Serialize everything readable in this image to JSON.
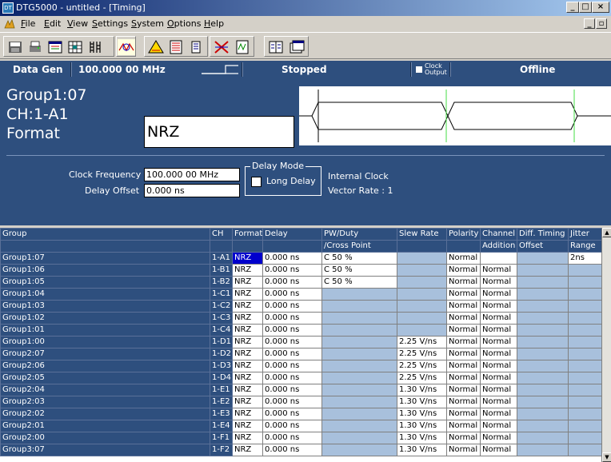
{
  "window": {
    "title": "DTG5000 - untitled - [Timing]",
    "app_icon": "DT"
  },
  "menu": [
    "File",
    "Edit",
    "View",
    "Settings",
    "System",
    "Options",
    "Help"
  ],
  "status": {
    "mode": "Data Gen",
    "frequency": "100.000 00 MHz",
    "run_state": "Stopped",
    "clock_output_line1": "Clock",
    "clock_output_line2": "Output",
    "connection": "Offline"
  },
  "channel": {
    "group": "Group1:07",
    "ch": "CH:1-A1",
    "format_label": "Format",
    "format_value": "NRZ"
  },
  "settings": {
    "clock_frequency_label": "Clock Frequency",
    "clock_frequency_value": "100.000 00 MHz",
    "delay_offset_label": "Delay Offset",
    "delay_offset_value": "0.000 ns",
    "delay_mode_legend": "Delay Mode",
    "long_delay_label": "Long Delay",
    "clock_source": "Internal Clock",
    "vector_rate": "Vector Rate : 1"
  },
  "grid": {
    "headers1": [
      "Group",
      "CH",
      "Format",
      "Delay",
      "PW/Duty",
      "Slew Rate",
      "Polarity",
      "Channel",
      "Diff. Timing",
      "Jitter"
    ],
    "headers2": [
      "",
      "",
      "",
      "",
      "/Cross Point",
      "",
      "",
      "Addition",
      "Offset",
      "Range"
    ],
    "rows": [
      [
        "Group1:07",
        "1-A1",
        "NRZ",
        "0.000 ns",
        "C 50 %",
        "",
        "Normal",
        "",
        "",
        "2ns"
      ],
      [
        "Group1:06",
        "1-B1",
        "NRZ",
        "0.000 ns",
        "C 50 %",
        "",
        "Normal",
        "Normal",
        "",
        ""
      ],
      [
        "Group1:05",
        "1-B2",
        "NRZ",
        "0.000 ns",
        "C 50 %",
        "",
        "Normal",
        "Normal",
        "",
        ""
      ],
      [
        "Group1:04",
        "1-C1",
        "NRZ",
        "0.000 ns",
        "",
        "",
        "Normal",
        "Normal",
        "",
        ""
      ],
      [
        "Group1:03",
        "1-C2",
        "NRZ",
        "0.000 ns",
        "",
        "",
        "Normal",
        "Normal",
        "",
        ""
      ],
      [
        "Group1:02",
        "1-C3",
        "NRZ",
        "0.000 ns",
        "",
        "",
        "Normal",
        "Normal",
        "",
        ""
      ],
      [
        "Group1:01",
        "1-C4",
        "NRZ",
        "0.000 ns",
        "",
        "",
        "Normal",
        "Normal",
        "",
        ""
      ],
      [
        "Group1:00",
        "1-D1",
        "NRZ",
        "0.000 ns",
        "",
        "2.25 V/ns",
        "Normal",
        "Normal",
        "",
        ""
      ],
      [
        "Group2:07",
        "1-D2",
        "NRZ",
        "0.000 ns",
        "",
        "2.25 V/ns",
        "Normal",
        "Normal",
        "",
        ""
      ],
      [
        "Group2:06",
        "1-D3",
        "NRZ",
        "0.000 ns",
        "",
        "2.25 V/ns",
        "Normal",
        "Normal",
        "",
        ""
      ],
      [
        "Group2:05",
        "1-D4",
        "NRZ",
        "0.000 ns",
        "",
        "2.25 V/ns",
        "Normal",
        "Normal",
        "",
        ""
      ],
      [
        "Group2:04",
        "1-E1",
        "NRZ",
        "0.000 ns",
        "",
        "1.30 V/ns",
        "Normal",
        "Normal",
        "",
        ""
      ],
      [
        "Group2:03",
        "1-E2",
        "NRZ",
        "0.000 ns",
        "",
        "1.30 V/ns",
        "Normal",
        "Normal",
        "",
        ""
      ],
      [
        "Group2:02",
        "1-E3",
        "NRZ",
        "0.000 ns",
        "",
        "1.30 V/ns",
        "Normal",
        "Normal",
        "",
        ""
      ],
      [
        "Group2:01",
        "1-E4",
        "NRZ",
        "0.000 ns",
        "",
        "1.30 V/ns",
        "Normal",
        "Normal",
        "",
        ""
      ],
      [
        "Group2:00",
        "1-F1",
        "NRZ",
        "0.000 ns",
        "",
        "1.30 V/ns",
        "Normal",
        "Normal",
        "",
        ""
      ],
      [
        "Group3:07",
        "1-F2",
        "NRZ",
        "0.000 ns",
        "",
        "1.30 V/ns",
        "Normal",
        "Normal",
        "",
        ""
      ]
    ]
  },
  "colors": {
    "panel": "#2e4f7e",
    "selection": "#0000cc",
    "empty_cell": "#a8c0dc",
    "marker": "#44dd44"
  }
}
